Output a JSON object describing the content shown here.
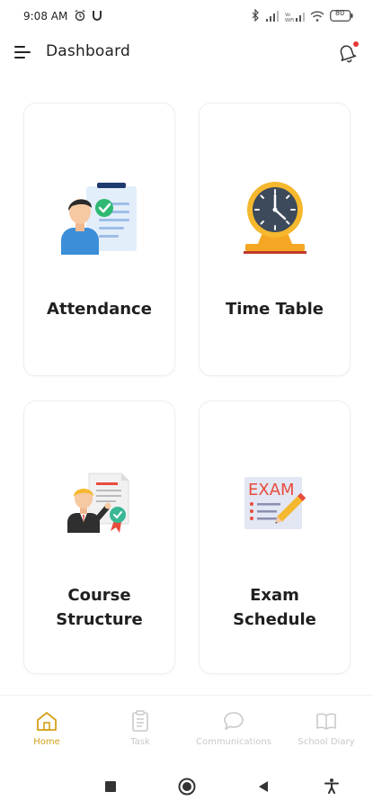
{
  "status_bar": {
    "time": "9:08 AM",
    "battery": "80"
  },
  "header": {
    "title": "Dashboard"
  },
  "cards": [
    {
      "label": "Attendance",
      "icon": "attendance-illustration"
    },
    {
      "label": "Time Table",
      "icon": "clock-illustration"
    },
    {
      "label_line1": "Course",
      "label_line2": "Structure",
      "icon": "course-certificate-illustration"
    },
    {
      "label_line1": "Exam",
      "label_line2": "Schedule",
      "icon": "exam-illustration",
      "icon_text": "EXAM"
    }
  ],
  "bottom_nav": [
    {
      "label": "Home",
      "active": true
    },
    {
      "label": "Task",
      "active": false
    },
    {
      "label": "Communications",
      "active": false
    },
    {
      "label": "School Diary",
      "active": false
    }
  ],
  "colors": {
    "accent": "#d4a017",
    "inactive": "#c9c9c9",
    "notification_dot": "#e53935"
  }
}
